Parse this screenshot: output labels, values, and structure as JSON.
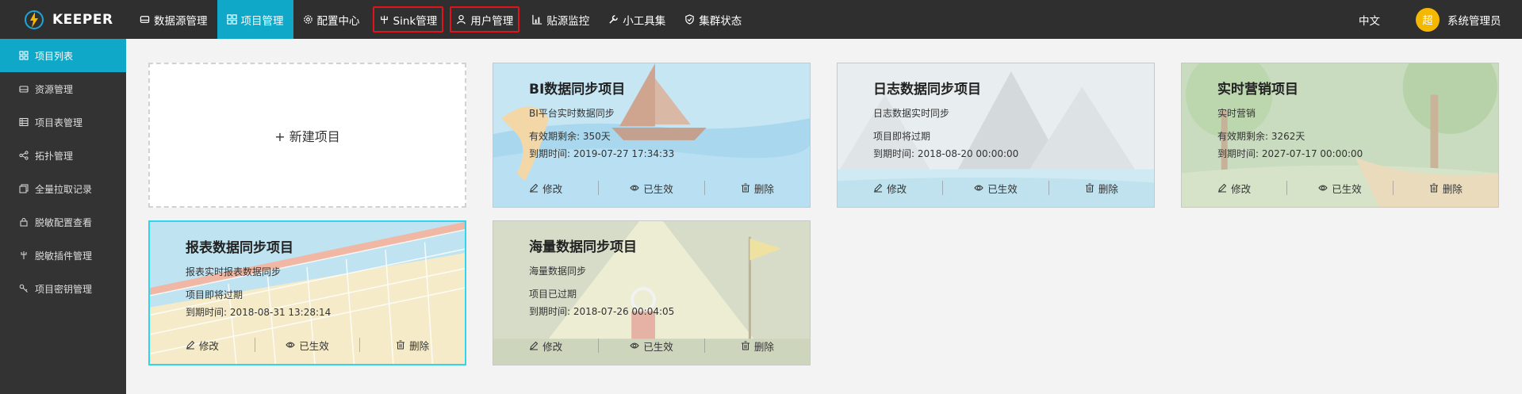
{
  "brand": {
    "name": "KEEPER",
    "logo_icon": "lightning-bolt-logo"
  },
  "nav": [
    {
      "label": "数据源管理",
      "icon": "database-icon"
    },
    {
      "label": "项目管理",
      "icon": "grid-icon",
      "active": true
    },
    {
      "label": "配置中心",
      "icon": "gear-icon"
    },
    {
      "label": "Sink管理",
      "icon": "branch-icon",
      "highlighted": true
    },
    {
      "label": "用户管理",
      "icon": "user-icon",
      "highlighted": true
    },
    {
      "label": "贴源监控",
      "icon": "bar-chart-icon"
    },
    {
      "label": "小工具集",
      "icon": "wrench-icon"
    },
    {
      "label": "集群状态",
      "icon": "shield-icon"
    }
  ],
  "header": {
    "language": "中文",
    "avatar_char": "超",
    "username": "系统管理员"
  },
  "sidebar": [
    {
      "label": "项目列表",
      "icon": "grid-icon",
      "active": true
    },
    {
      "label": "资源管理",
      "icon": "drive-icon"
    },
    {
      "label": "项目表管理",
      "icon": "table-icon"
    },
    {
      "label": "拓扑管理",
      "icon": "share-icon"
    },
    {
      "label": "全量拉取记录",
      "icon": "copy-icon"
    },
    {
      "label": "脱敏配置查看",
      "icon": "lock-icon"
    },
    {
      "label": "脱敏插件管理",
      "icon": "plug-icon"
    },
    {
      "label": "项目密钥管理",
      "icon": "key-icon"
    }
  ],
  "new_project": {
    "label": "+ 新建项目"
  },
  "actions": {
    "edit": "修改",
    "active": "已生效",
    "delete": "删除"
  },
  "cards": [
    {
      "title": "BI数据同步项目",
      "desc": "BI平台实时数据同步",
      "status": "有效期剩余: 350天",
      "expire": "到期时间: 2019-07-27 17:34:33",
      "theme": "sailboat"
    },
    {
      "title": "日志数据同步项目",
      "desc": "日志数据实时同步",
      "status": "项目即将过期",
      "expire": "到期时间: 2018-08-20 00:00:00",
      "theme": "mountains"
    },
    {
      "title": "实时营销项目",
      "desc": "实时营销",
      "status": "有效期剩余: 3262天",
      "expire": "到期时间: 2027-07-17 00:00:00",
      "theme": "forest"
    },
    {
      "title": "报表数据同步项目",
      "desc": "报表实时报表数据同步",
      "status": "项目即将过期",
      "expire": "到期时间: 2018-08-31 13:28:14",
      "theme": "volleyball-net",
      "selected": true
    },
    {
      "title": "海量数据同步项目",
      "desc": "海量数据同步",
      "status": "项目已过期",
      "expire": "到期时间: 2018-07-26 00:04:05",
      "theme": "spotlight"
    }
  ],
  "colors": {
    "topbar": "#2f2f2f",
    "accent": "#0fa8c8",
    "highlight_box": "#e0141a",
    "avatar": "#f5b800"
  }
}
